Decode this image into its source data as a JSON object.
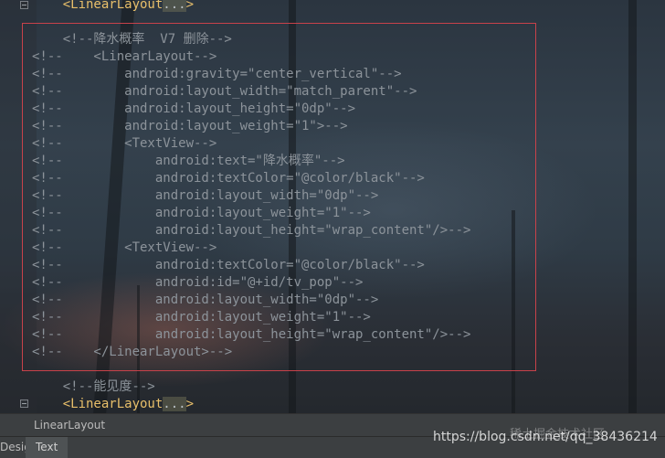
{
  "editor": {
    "lines": [
      {
        "parts": [
          {
            "t": "    "
          },
          {
            "t": "<LinearLayout",
            "c": "tag"
          },
          {
            "t": "...",
            "c": "ellipsis"
          },
          {
            "t": ">",
            "c": "tag"
          }
        ]
      },
      {
        "parts": [
          {
            "t": ""
          }
        ]
      },
      {
        "parts": [
          {
            "t": "    <!--降水概率  V7 删除-->",
            "c": "comment"
          }
        ]
      },
      {
        "parts": [
          {
            "t": "<!--    <LinearLayout-->",
            "c": "comment"
          }
        ]
      },
      {
        "parts": [
          {
            "t": "<!--        android:gravity=\"center_vertical\"-->",
            "c": "comment"
          }
        ]
      },
      {
        "parts": [
          {
            "t": "<!--        android:layout_width=\"match_parent\"-->",
            "c": "comment"
          }
        ]
      },
      {
        "parts": [
          {
            "t": "<!--        android:layout_height=\"0dp\"-->",
            "c": "comment"
          }
        ]
      },
      {
        "parts": [
          {
            "t": "<!--        android:layout_weight=\"1\">-->",
            "c": "comment"
          }
        ]
      },
      {
        "parts": [
          {
            "t": "<!--        <TextView-->",
            "c": "comment"
          }
        ]
      },
      {
        "parts": [
          {
            "t": "<!--            android:text=\"降水概率\"-->",
            "c": "comment"
          }
        ]
      },
      {
        "parts": [
          {
            "t": "<!--            android:textColor=\"@color/black\"-->",
            "c": "comment"
          }
        ]
      },
      {
        "parts": [
          {
            "t": "<!--            android:layout_width=\"0dp\"-->",
            "c": "comment"
          }
        ]
      },
      {
        "parts": [
          {
            "t": "<!--            android:layout_weight=\"1\"-->",
            "c": "comment"
          }
        ]
      },
      {
        "parts": [
          {
            "t": "<!--            android:layout_height=\"wrap_content\"/>-->",
            "c": "comment"
          }
        ]
      },
      {
        "parts": [
          {
            "t": "<!--        <TextView-->",
            "c": "comment"
          }
        ]
      },
      {
        "parts": [
          {
            "t": "<!--            android:textColor=\"@color/black\"-->",
            "c": "comment"
          }
        ]
      },
      {
        "parts": [
          {
            "t": "<!--            android:id=\"@+id/tv_pop\"-->",
            "c": "comment"
          }
        ]
      },
      {
        "parts": [
          {
            "t": "<!--            android:layout_width=\"0dp\"-->",
            "c": "comment"
          }
        ]
      },
      {
        "parts": [
          {
            "t": "<!--            android:layout_weight=\"1\"-->",
            "c": "comment"
          }
        ]
      },
      {
        "parts": [
          {
            "t": "<!--            android:layout_height=\"wrap_content\"/>-->",
            "c": "comment"
          }
        ]
      },
      {
        "parts": [
          {
            "t": "<!--    </LinearLayout>-->",
            "c": "comment"
          }
        ]
      },
      {
        "parts": [
          {
            "t": ""
          }
        ]
      },
      {
        "parts": [
          {
            "t": "    <!--能见度-->",
            "c": "comment"
          }
        ]
      },
      {
        "parts": [
          {
            "t": "    "
          },
          {
            "t": "<LinearLayout",
            "c": "tag"
          },
          {
            "t": "...",
            "c": "ellipsis"
          },
          {
            "t": ">",
            "c": "tag"
          }
        ]
      }
    ]
  },
  "breadcrumb": {
    "item": "LinearLayout"
  },
  "tabs": {
    "design": "Design",
    "text": "Text"
  },
  "watermark": {
    "url": "https://blog.csdn.net/qq_38436214",
    "cn": "稀土掘金技术社区"
  },
  "colors": {
    "tag": "#e8bf6a",
    "comment": "#8c939a",
    "selection_border": "#c8424a"
  }
}
